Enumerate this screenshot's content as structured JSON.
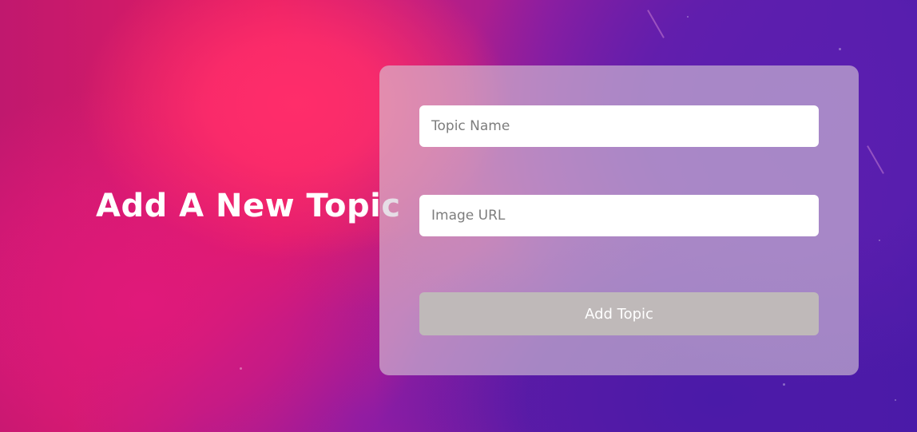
{
  "page": {
    "title": "Add A New Topic"
  },
  "form": {
    "topic_name_placeholder": "Topic Name",
    "topic_name_value": "",
    "image_url_placeholder": "Image URL",
    "image_url_value": "",
    "submit_label": "Add Topic"
  },
  "colors": {
    "background_pink": "#ff2d6a",
    "background_purple": "#4b1ca6",
    "card_overlay": "#d7c8d7",
    "button_bg": "#bfb9b9",
    "button_text": "#ffffff"
  }
}
